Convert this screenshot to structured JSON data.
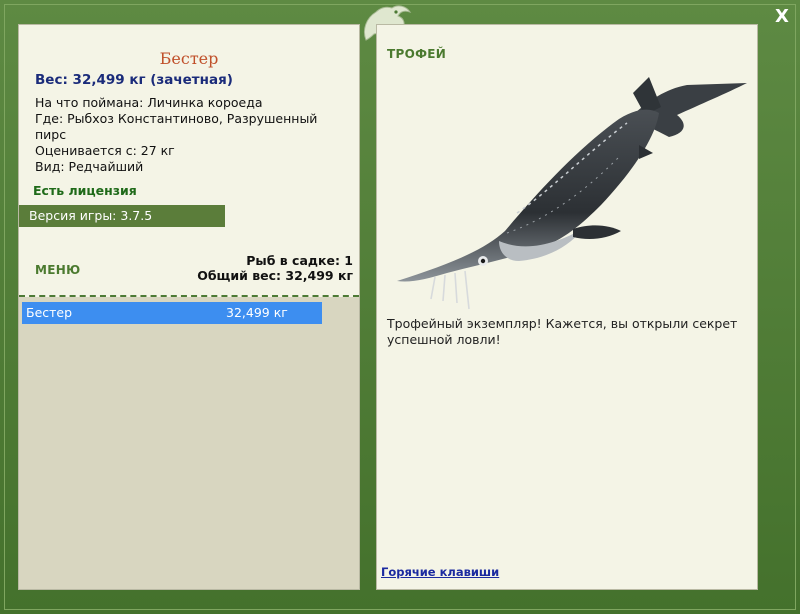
{
  "window": {
    "close_label": "X"
  },
  "fish": {
    "title": "Бестер",
    "weight_line": "Вес: 32,499 кг (зачетная)",
    "bait": "На что поймана: Личинка короеда",
    "location": "Где: Рыбхоз Константиново, Разрушенный пирс",
    "valued_from": "Оценивается с: 27 кг",
    "rarity": "Вид: Редчайший"
  },
  "license": "Есть лицензия",
  "version": "Версия игры: 3.7.5",
  "menu_label": "МЕНЮ",
  "keepnet": {
    "count_line": "Рыб в садке: 1",
    "total_line": "Общий вес: 32,499 кг",
    "items": [
      {
        "name": "Бестер",
        "weight": "32,499 кг"
      }
    ]
  },
  "trophy": {
    "label": "ТРОФЕЙ",
    "text": "Трофейный экземпляр! Кажется, вы открыли секрет успешной ловли!"
  },
  "hotkeys_link": "Горячие клавиши",
  "colors": {
    "frame": "#4d7a35",
    "panel": "#f4f4e6",
    "selection": "#3d8ef0",
    "title": "#c0502a",
    "weight": "#1a2b7a"
  }
}
